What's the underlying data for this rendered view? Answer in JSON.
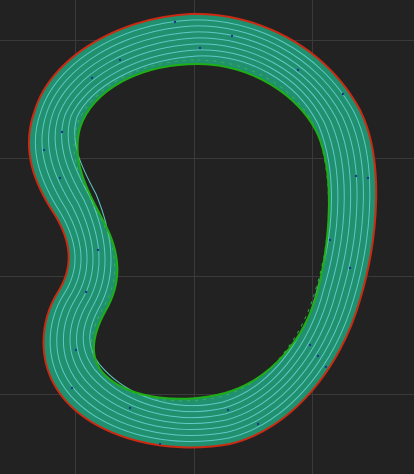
{
  "viewport": {
    "background_color": "#222222",
    "grid_color": "#3a3a3a",
    "grid": true
  },
  "toolpath": {
    "shape": "kidney-bean",
    "pass_count": 8,
    "colors": {
      "outer_perimeter": "#cc2a12",
      "inner_perimeter": "#1fae16",
      "infill_fill": "#20906e",
      "infill_lines": "#5ec8c6",
      "inner_lines": "#39b94a",
      "seam_points": "#1a3a8c"
    }
  }
}
